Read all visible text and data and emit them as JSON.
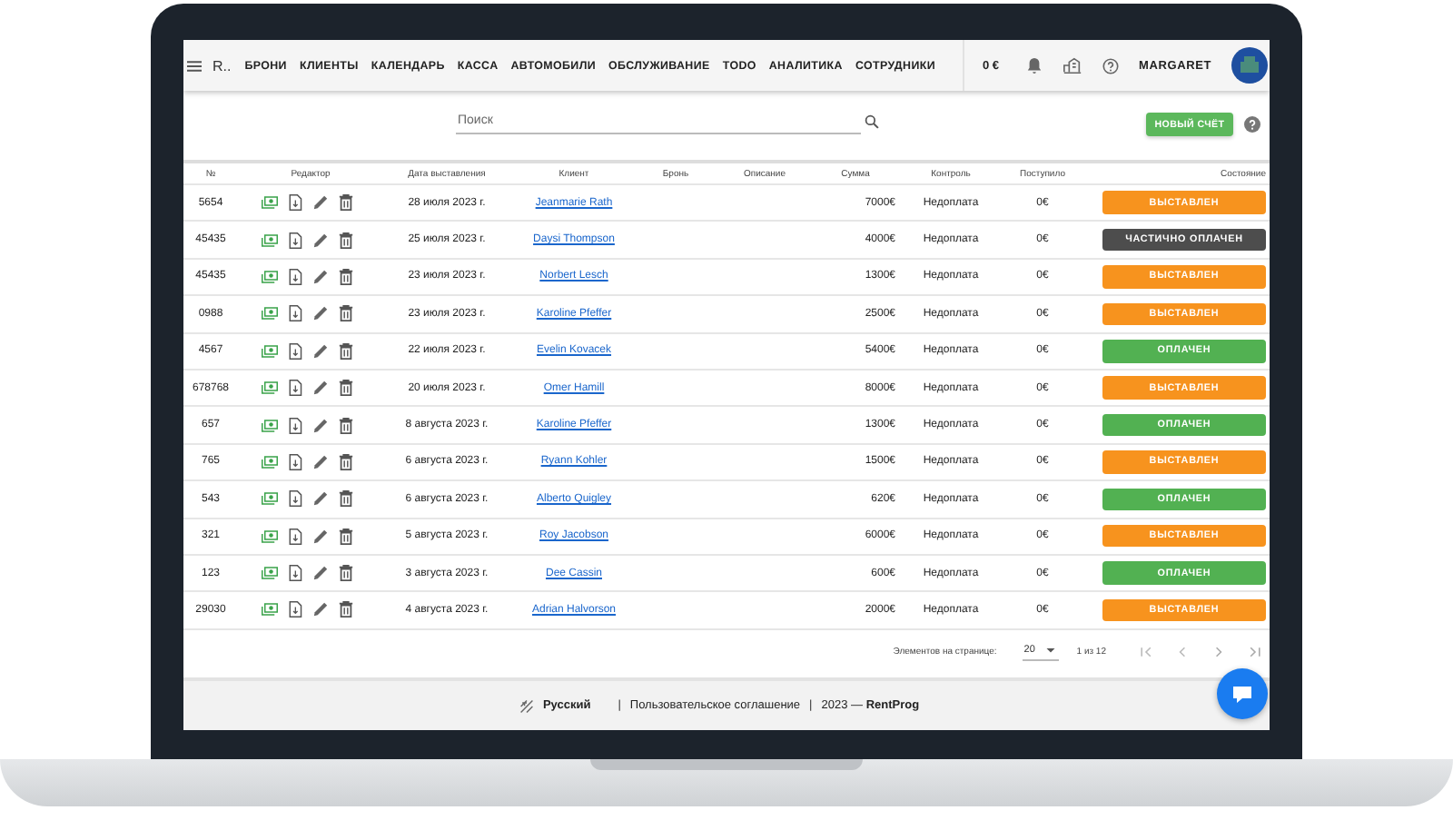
{
  "nav": {
    "brand": "R..",
    "items": [
      "БРОНИ",
      "КЛИЕНТЫ",
      "КАЛЕНДАРЬ",
      "КАССА",
      "АВТОМОБИЛИ",
      "ОБСЛУЖИВАНИЕ",
      "TODO",
      "АНАЛИТИКА",
      "СОТРУДНИКИ"
    ],
    "balance": "0 €",
    "user": "MARGARET"
  },
  "search": {
    "placeholder": "Поиск"
  },
  "new_button": "НОВЫЙ СЧЁТ",
  "table": {
    "columns": [
      "№",
      "Редактор",
      "Дата выставления",
      "Клиент",
      "Бронь",
      "Описание",
      "Сумма",
      "Контроль",
      "Поступило",
      "Состояние"
    ],
    "rows": [
      {
        "number": "5654",
        "date": "28 июля 2023 г.",
        "client": "Jeanmarie Rath",
        "sum": "7000€",
        "control": "Недоплата",
        "received": "0€",
        "status": "ВЫСТАВЛЕН",
        "kind": "issued"
      },
      {
        "number": "45435",
        "date": "25 июля 2023 г.",
        "client": "Daysi Thompson",
        "sum": "4000€",
        "control": "Недоплата",
        "received": "0€",
        "status": "ЧАСТИЧНО ОПЛАЧЕН",
        "kind": "partial"
      },
      {
        "number": "45435",
        "date": "23 июля 2023 г.",
        "client": "Norbert Lesch",
        "sum": "1300€",
        "control": "Недоплата",
        "received": "0€",
        "status": "ВЫСТАВЛЕН",
        "kind": "issued"
      },
      {
        "number": "0988",
        "date": "23 июля 2023 г.",
        "client": "Karoline Pfeffer",
        "sum": "2500€",
        "control": "Недоплата",
        "received": "0€",
        "status": "ВЫСТАВЛЕН",
        "kind": "issued"
      },
      {
        "number": "4567",
        "date": "22 июля 2023 г.",
        "client": "Evelin Kovacek",
        "sum": "5400€",
        "control": "Недоплата",
        "received": "0€",
        "status": "ОПЛАЧЕН",
        "kind": "paid"
      },
      {
        "number": "678768",
        "date": "20 июля 2023 г.",
        "client": "Omer Hamill",
        "sum": "8000€",
        "control": "Недоплата",
        "received": "0€",
        "status": "ВЫСТАВЛЕН",
        "kind": "issued"
      },
      {
        "number": "657",
        "date": "8 августа 2023 г.",
        "client": "Karoline Pfeffer",
        "sum": "1300€",
        "control": "Недоплата",
        "received": "0€",
        "status": "ОПЛАЧЕН",
        "kind": "paid"
      },
      {
        "number": "765",
        "date": "6 августа 2023 г.",
        "client": "Ryann Kohler",
        "sum": "1500€",
        "control": "Недоплата",
        "received": "0€",
        "status": "ВЫСТАВЛЕН",
        "kind": "issued"
      },
      {
        "number": "543",
        "date": "6 августа 2023 г.",
        "client": "Alberto Quigley",
        "sum": "620€",
        "control": "Недоплата",
        "received": "0€",
        "status": "ОПЛАЧЕН",
        "kind": "paid"
      },
      {
        "number": "321",
        "date": "5 августа 2023 г.",
        "client": "Roy Jacobson",
        "sum": "6000€",
        "control": "Недоплата",
        "received": "0€",
        "status": "ВЫСТАВЛЕН",
        "kind": "issued"
      },
      {
        "number": "123",
        "date": "3 августа 2023 г.",
        "client": "Dee Cassin",
        "sum": "600€",
        "control": "Недоплата",
        "received": "0€",
        "status": "ОПЛАЧЕН",
        "kind": "paid"
      },
      {
        "number": "29030",
        "date": "4 августа 2023 г.",
        "client": "Adrian Halvorson",
        "sum": "2000€",
        "control": "Недоплата",
        "received": "0€",
        "status": "ВЫСТАВЛЕН",
        "kind": "issued"
      }
    ]
  },
  "pagination": {
    "label": "Элементов на странице:",
    "per_page": "20",
    "range": "1 из 12"
  },
  "footer": {
    "language": "Русский",
    "separators": [
      "|",
      "|"
    ],
    "agreement": "Пользовательское соглашение",
    "copyright": "2023 — **RentProg**"
  }
}
